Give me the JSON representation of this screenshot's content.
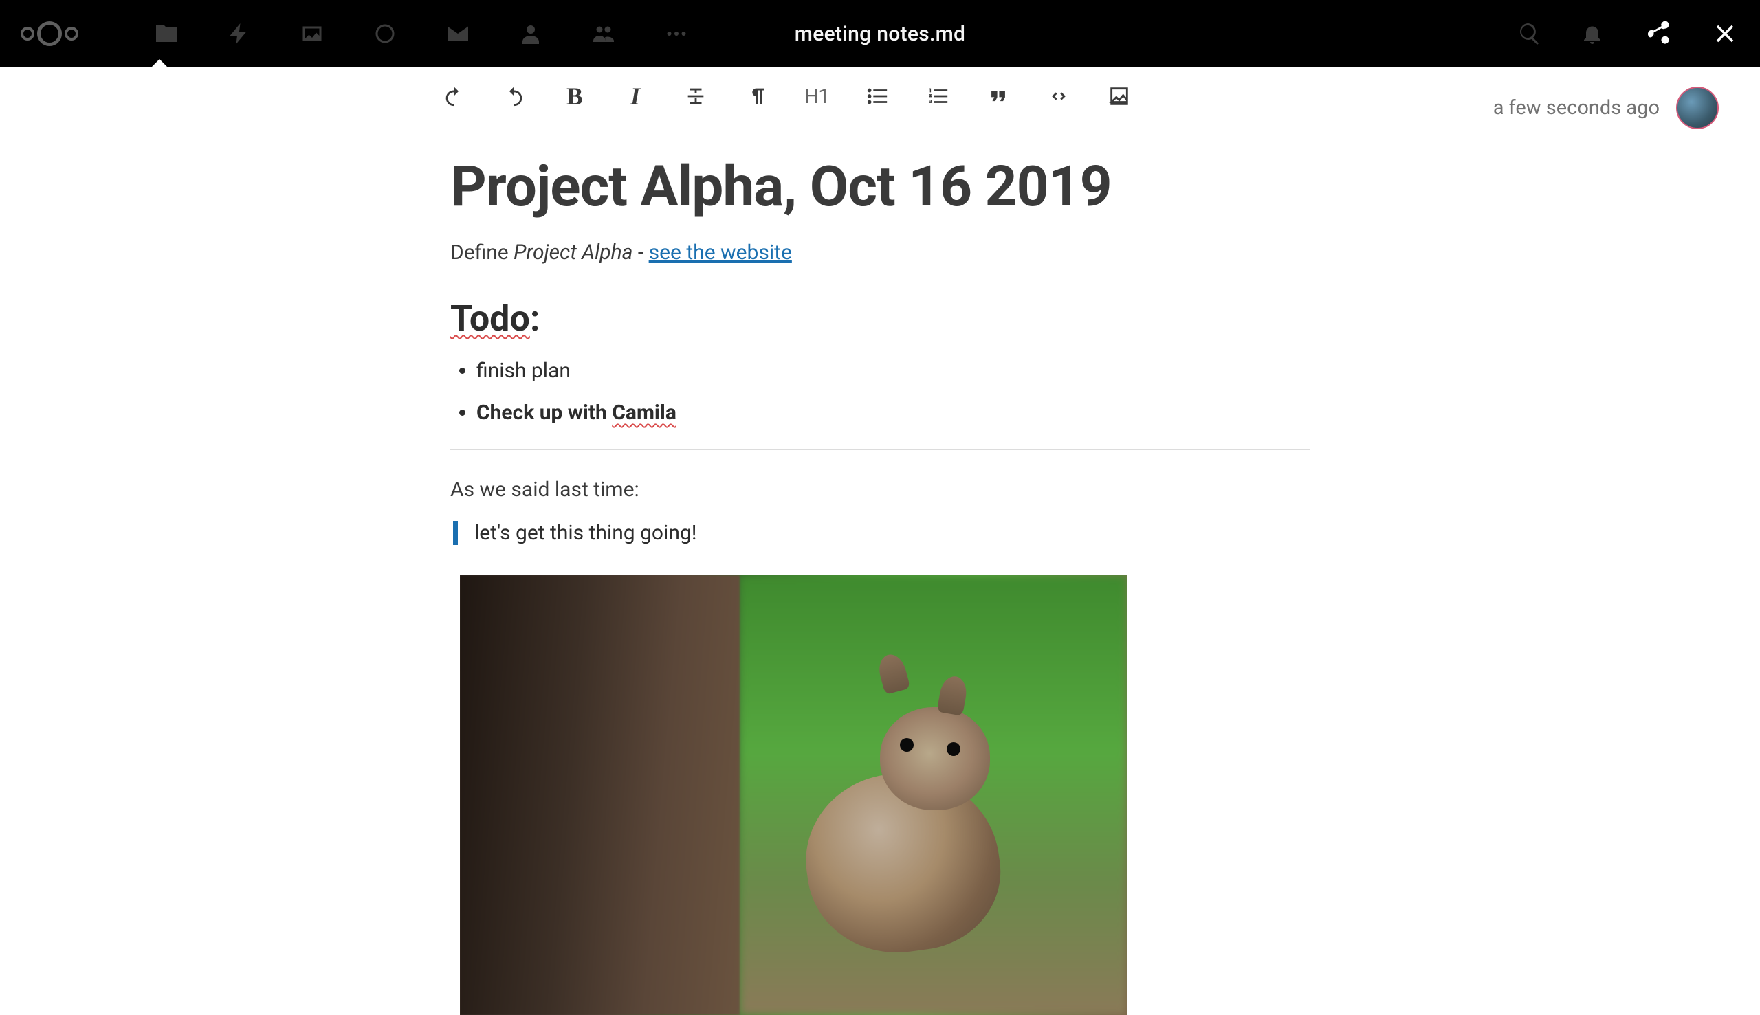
{
  "topbar": {
    "title": "meeting notes.md"
  },
  "toolbar": {
    "h1": "H1"
  },
  "meta": {
    "save_status": "a few seconds ago"
  },
  "doc": {
    "h1": "Project Alpha, Oct 16 2019",
    "intro_prefix": "Define ",
    "intro_em": "Project Alpha",
    "intro_sep": " - ",
    "intro_link": "see the website",
    "h2_under": "Todo",
    "h2_rest": ":",
    "todo": [
      "finish plan",
      "Check up with Camila"
    ],
    "todo2_prefix": "Check up with ",
    "todo2_spell": "Camila",
    "para2": "As we said last time:",
    "quote": "let's get this thing going!"
  }
}
